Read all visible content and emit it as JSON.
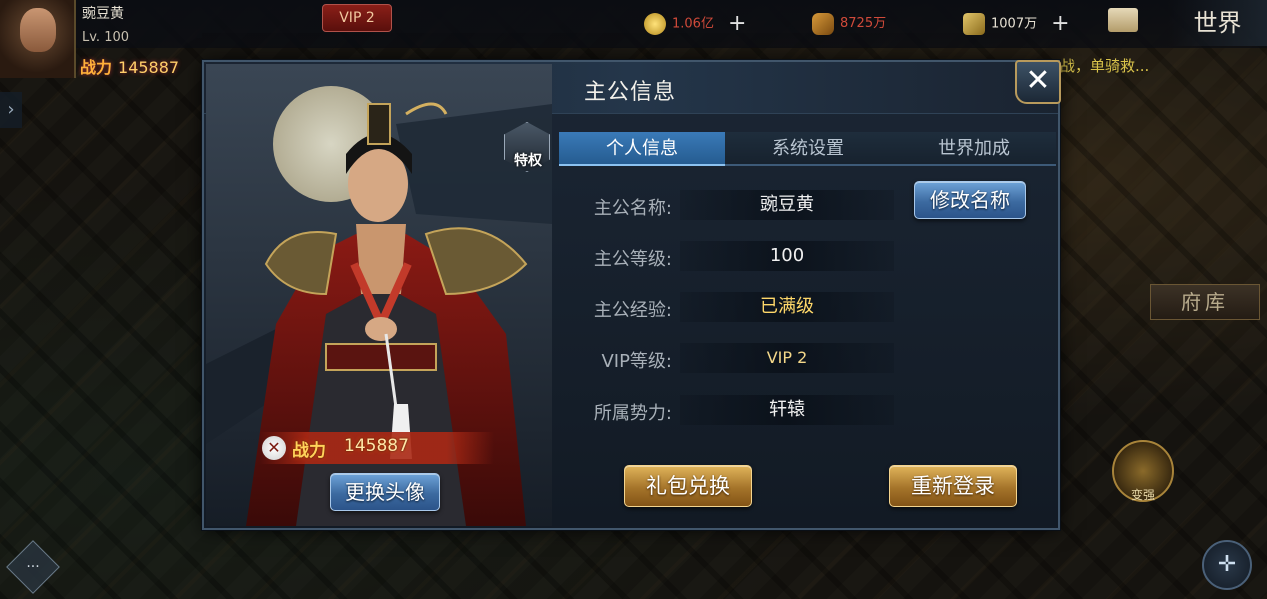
{
  "hud": {
    "player_name": "豌豆黄",
    "player_level": "Lv. 100",
    "power_label": "战力",
    "power_value": "145887",
    "vip_label": "VIP 2",
    "gold": "1.06亿",
    "food": "8725万",
    "soldiers": "1007万",
    "plus": "+",
    "world_label": "世界",
    "ticker": "战，单骑救...",
    "fuku_label": "府库",
    "bianqiang_label": "变强",
    "chat_label": "···"
  },
  "dialog": {
    "title": "主公信息",
    "close_symbol": "✕",
    "privilege_label": "特权",
    "power_label": "战力",
    "power_value": "145887",
    "change_avatar_label": "更换头像",
    "tabs": [
      {
        "label": "个人信息",
        "active": true
      },
      {
        "label": "系统设置",
        "active": false
      },
      {
        "label": "世界加成",
        "active": false
      }
    ],
    "rows": [
      {
        "label": "主公名称:",
        "value": "豌豆黄"
      },
      {
        "label": "主公等级:",
        "value": "100"
      },
      {
        "label": "主公经验:",
        "value": "已满级"
      },
      {
        "label": "VIP等级:",
        "value": "VIP  2"
      },
      {
        "label": "所属势力:",
        "value": "轩辕"
      }
    ],
    "rename_label": "修改名称",
    "gift_label": "礼包兑换",
    "relogin_label": "重新登录"
  },
  "colors": {
    "accent_blue": "#3a7ab8",
    "gold_text": "#ffd86a",
    "panel_bg": "#1b2634"
  },
  "icons": [
    "close-icon",
    "privilege-icon",
    "crossed-swords-icon",
    "gold-coin-icon",
    "food-icon",
    "soldier-icon",
    "mail-icon",
    "compass-icon",
    "chat-icon"
  ]
}
